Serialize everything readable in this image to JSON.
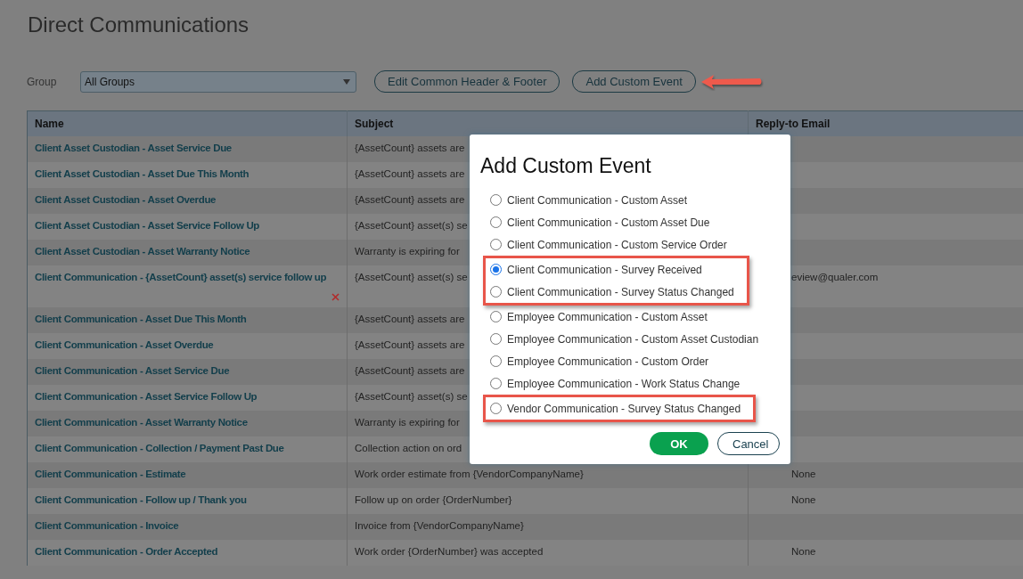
{
  "page": {
    "title": "Direct Communications"
  },
  "filter": {
    "label": "Group",
    "value": "All Groups"
  },
  "buttons": [
    {
      "label": "Edit Common Header & Footer",
      "pointed": false
    },
    {
      "label": "Add Custom Event",
      "pointed": true
    }
  ],
  "table": {
    "columns": [
      "Name",
      "Subject",
      "Reply-to Email"
    ],
    "rows": [
      {
        "name": "Client Asset Custodian - Asset Service Due",
        "subject": "{AssetCount} assets are",
        "deletable": false
      },
      {
        "name": "Client Asset Custodian - Asset Due This Month",
        "subject": "{AssetCount} assets are",
        "deletable": false
      },
      {
        "name": "Client Asset Custodian - Asset Overdue",
        "subject": "{AssetCount} assets are",
        "deletable": false
      },
      {
        "name": "Client Asset Custodian - Asset Service Follow Up",
        "subject": "{AssetCount} asset(s) se",
        "deletable": false
      },
      {
        "name": "Client Asset Custodian - Asset Warranty Notice",
        "subject": "Warranty is expiring for",
        "deletable": false
      },
      {
        "name": "Client Communication - {AssetCount} asset(s) service follow up",
        "subject": "{AssetCount} asset(s) se",
        "reply_to": "eview@qualer.com",
        "deletable": true
      },
      {
        "name": "Client Communication - Asset Due This Month",
        "subject": "{AssetCount} assets are",
        "deletable": false
      },
      {
        "name": "Client Communication - Asset Overdue",
        "subject": "{AssetCount} assets are",
        "deletable": false
      },
      {
        "name": "Client Communication - Asset Service Due",
        "subject": "{AssetCount} assets are",
        "deletable": false
      },
      {
        "name": "Client Communication - Asset Service Follow Up",
        "subject": "{AssetCount} asset(s) se",
        "deletable": false
      },
      {
        "name": "Client Communication - Asset Warranty Notice",
        "subject": "Warranty is expiring for",
        "deletable": false
      },
      {
        "name": "Client Communication - Collection / Payment Past Due",
        "subject": "Collection action on ord",
        "deletable": false
      },
      {
        "name": "Client Communication - Estimate",
        "subject": "Work order estimate from {VendorCompanyName}",
        "reply_to": "None",
        "deletable": false
      },
      {
        "name": "Client Communication - Follow up / Thank you",
        "subject": "Follow up on order {OrderNumber}",
        "reply_to": "None",
        "deletable": false
      },
      {
        "name": "Client Communication - Invoice",
        "subject": "Invoice from {VendorCompanyName}",
        "deletable": false
      },
      {
        "name": "Client Communication - Order Accepted",
        "subject": "Work order {OrderNumber} was accepted",
        "reply_to": "None",
        "deletable": false
      }
    ]
  },
  "dialog": {
    "title": "Add Custom Event",
    "options": [
      {
        "label": "Client Communication - Custom Asset",
        "selected": false,
        "highlighted": false
      },
      {
        "label": "Client Communication - Custom Asset Due",
        "selected": false,
        "highlighted": false
      },
      {
        "label": "Client Communication - Custom Service Order",
        "selected": false,
        "highlighted": false
      },
      {
        "label": "Client Communication - Survey Received",
        "selected": true,
        "highlighted": true
      },
      {
        "label": "Client Communication - Survey Status Changed",
        "selected": false,
        "highlighted": true
      },
      {
        "label": "Employee Communication - Custom Asset",
        "selected": false,
        "highlighted": false
      },
      {
        "label": "Employee Communication - Custom Asset Custodian",
        "selected": false,
        "highlighted": false
      },
      {
        "label": "Employee Communication - Custom Order",
        "selected": false,
        "highlighted": false
      },
      {
        "label": "Employee Communication - Work Status Change",
        "selected": false,
        "highlighted": false
      },
      {
        "label": "Vendor Communication - Survey Status Changed",
        "selected": false,
        "highlighted": true
      }
    ],
    "buttons": [
      {
        "label": "OK",
        "kind": "primary"
      },
      {
        "label": "Cancel",
        "kind": "secondary"
      }
    ]
  }
}
